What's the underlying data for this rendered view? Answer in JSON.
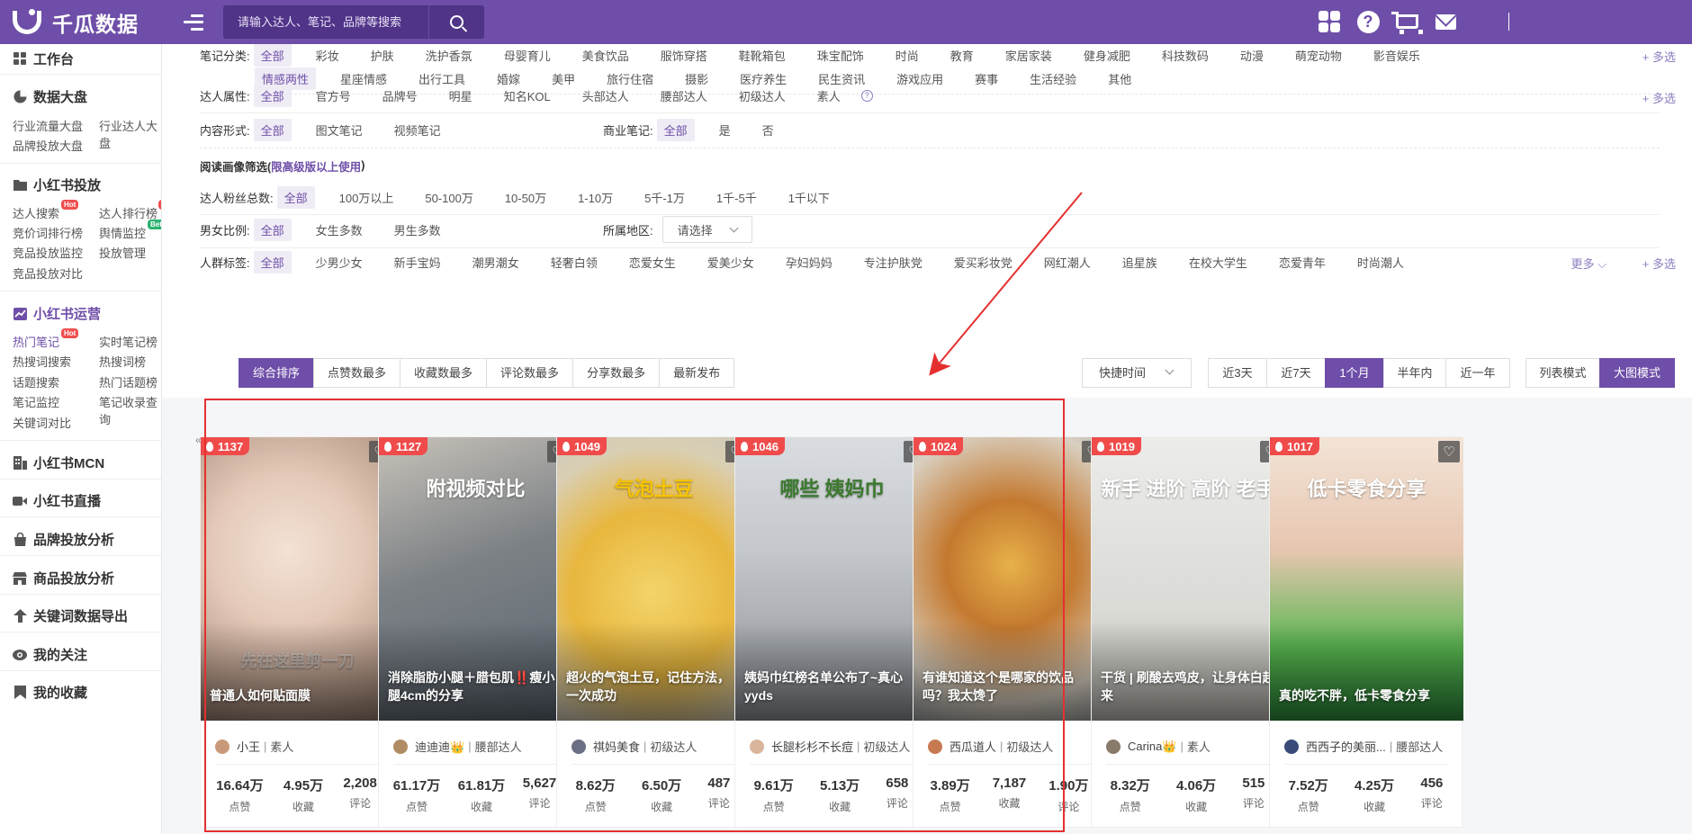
{
  "app": {
    "logo_text": "千瓜数据",
    "search_placeholder": "请输入达人、笔记、品牌等搜索"
  },
  "sidebar": {
    "workbench": "工作台",
    "dashboard": {
      "title": "数据大盘",
      "items": [
        "行业流量大盘",
        "行业达人大盘",
        "品牌投放大盘"
      ]
    },
    "xhs_ads": {
      "title": "小红书投放",
      "items": [
        "达人搜索",
        "达人排行榜",
        "竞价词排行榜",
        "舆情监控",
        "竞品投放监控",
        "投放管理",
        "竞品投放对比"
      ],
      "hot": "Hot",
      "beta": "Beta"
    },
    "xhs_ops": {
      "title": "小红书运营",
      "items": [
        "热门笔记",
        "实时笔记榜",
        "热搜词搜索",
        "热搜词榜",
        "话题搜索",
        "热门话题榜",
        "笔记监控",
        "笔记收录查询",
        "关键词对比"
      ],
      "hot": "Hot"
    },
    "mcn": "小红书MCN",
    "live": "小红书直播",
    "brand_analysis": "品牌投放分析",
    "product_analysis": "商品投放分析",
    "keyword_export": "关键词数据导出",
    "follow": "我的关注",
    "favorites": "我的收藏"
  },
  "filters": {
    "category": {
      "label": "笔记分类:",
      "row1": [
        "全部",
        "彩妆",
        "护肤",
        "洗护香氛",
        "母婴育儿",
        "美食饮品",
        "服饰穿搭",
        "鞋靴箱包",
        "珠宝配饰",
        "时尚",
        "教育",
        "家居家装",
        "健身减肥",
        "科技数码",
        "动漫",
        "萌宠动物",
        "影音娱乐"
      ],
      "row2": [
        "情感两性",
        "星座情感",
        "出行工具",
        "婚嫁",
        "美甲",
        "旅行住宿",
        "摄影",
        "医疗养生",
        "民生资讯",
        "游戏应用",
        "赛事",
        "生活经验",
        "其他"
      ]
    },
    "multi": "+ 多选",
    "talent": {
      "label": "达人属性:",
      "options": [
        "全部",
        "官方号",
        "品牌号",
        "明星",
        "知名KOL",
        "头部达人",
        "腰部达人",
        "初级达人",
        "素人"
      ],
      "help": "?"
    },
    "content": {
      "label": "内容形式:",
      "options": [
        "全部",
        "图文笔记",
        "视频笔记"
      ]
    },
    "commercial": {
      "label": "商业笔记:",
      "options": [
        "全部",
        "是",
        "否"
      ]
    },
    "reader_title": "阅读画像筛选(",
    "reader_highlight": "限高级版以上使用",
    "reader_close": ")",
    "fans": {
      "label": "达人粉丝总数:",
      "options": [
        "全部",
        "100万以上",
        "50-100万",
        "10-50万",
        "1-10万",
        "5千-1万",
        "1千-5千",
        "1千以下"
      ]
    },
    "gender": {
      "label": "男女比例:",
      "options": [
        "全部",
        "女生多数",
        "男生多数"
      ]
    },
    "region": {
      "label": "所属地区:",
      "placeholder": "请选择"
    },
    "crowd": {
      "label": "人群标签:",
      "options": [
        "全部",
        "少男少女",
        "新手宝妈",
        "潮男潮女",
        "轻奢白领",
        "恋爱女生",
        "爱美少女",
        "孕妇妈妈",
        "专注护肤党",
        "爱买彩妆党",
        "网红潮人",
        "追星族",
        "在校大学生",
        "恋爱青年",
        "时尚潮人"
      ],
      "more": "更多"
    },
    "sort_tabs": [
      "综合排序",
      "点赞数最多",
      "收藏数最多",
      "评论数最多",
      "分享数最多",
      "最新发布"
    ],
    "quick_time": "快捷时间",
    "time_tabs": [
      "近3天",
      "近7天",
      "1个月",
      "半年内",
      "近一年"
    ],
    "view_tabs": [
      "列表模式",
      "大图模式"
    ]
  },
  "stat_labels": {
    "likes": "点赞",
    "collects": "收藏",
    "comments": "评论"
  },
  "cards": [
    {
      "hot": "1137",
      "caption": "普通人如何贴面膜",
      "overlay": "先在这里剪一刀",
      "author": "小王",
      "level": "素人",
      "likes": "16.64万",
      "collects": "4.95万",
      "comments": "2,208"
    },
    {
      "hot": "1127",
      "caption": "消除脂肪小腿＋腊包肌‼️瘦小腿4cm的分享",
      "overlay": "附视频对比",
      "author": "迪迪迪👑",
      "level": "腰部达人",
      "likes": "61.17万",
      "collects": "61.81万",
      "comments": "5,627"
    },
    {
      "hot": "1049",
      "caption": "超火的气泡土豆，记住方法，一次成功",
      "overlay": "气泡土豆",
      "author": "祺妈美食",
      "level": "初级达人",
      "likes": "8.62万",
      "collects": "6.50万",
      "comments": "487"
    },
    {
      "hot": "1046",
      "caption": "姨妈巾红榜名单公布了~真心yyds",
      "overlay": "哪些 姨妈巾",
      "author": "长腿杉杉不长痘",
      "level": "初级达人",
      "likes": "9.61万",
      "collects": "5.13万",
      "comments": "658"
    },
    {
      "hot": "1024",
      "caption": "有谁知道这个是哪家的饮品吗？我太馋了",
      "overlay": "",
      "author": "西瓜道人",
      "level": "初级达人",
      "likes": "3.89万",
      "collects": "7,187",
      "comments": "1.90万"
    },
    {
      "hot": "1019",
      "caption": "干货 | 刷酸去鸡皮，让身体白起来",
      "overlay": "新手 进阶 高阶 老手",
      "author": "Carina👑",
      "level": "素人",
      "likes": "8.32万",
      "collects": "4.06万",
      "comments": "515"
    },
    {
      "hot": "1017",
      "caption": "真的吃不胖，低卡零食分享",
      "overlay": "低卡零食分享",
      "author": "西西子的美丽...",
      "level": "腰部达人",
      "likes": "7.52万",
      "collects": "4.25万",
      "comments": "456"
    }
  ],
  "colors": {
    "brand": "#6e4ea8",
    "hot": "#f04b4b",
    "annotation": "#e53030"
  }
}
